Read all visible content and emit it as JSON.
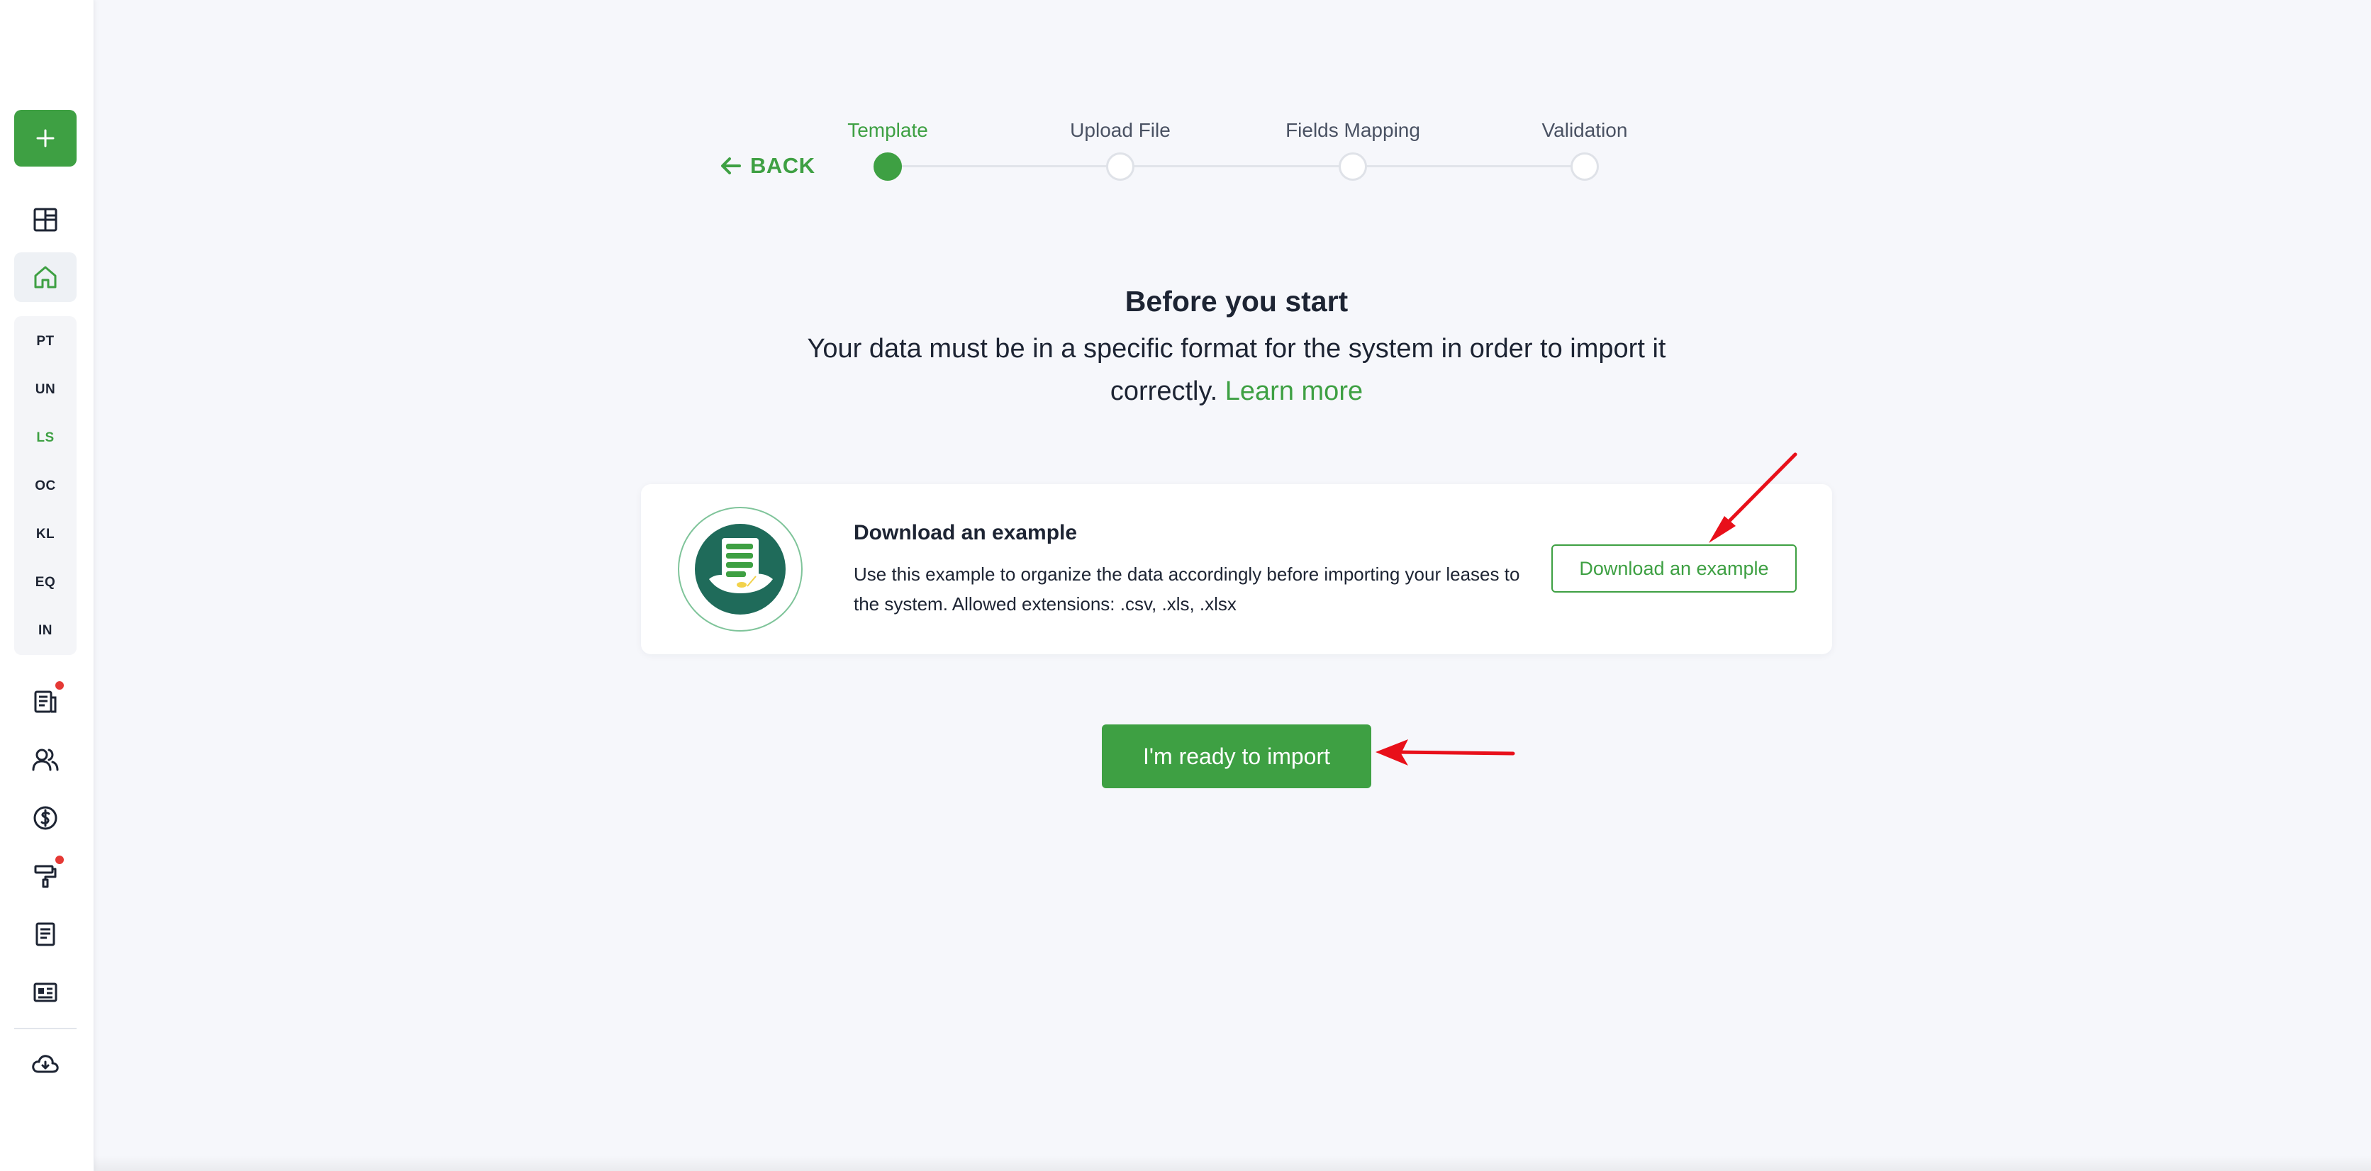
{
  "sidebar": {
    "add_icon": "plus-icon",
    "icons": [
      "dashboard-icon",
      "home-icon",
      "document-icon",
      "users-icon",
      "dollar-icon",
      "paint-roller-icon",
      "report-icon",
      "id-card-icon",
      "cloud-download-icon"
    ],
    "abbreviations": [
      "PT",
      "UN",
      "LS",
      "OC",
      "KL",
      "EQ",
      "IN"
    ],
    "active_abbreviation": "LS"
  },
  "stepper": {
    "back_label": "BACK",
    "steps": [
      {
        "label": "Template",
        "active": true
      },
      {
        "label": "Upload File",
        "active": false
      },
      {
        "label": "Fields Mapping",
        "active": false
      },
      {
        "label": "Validation",
        "active": false
      }
    ]
  },
  "intro": {
    "title": "Before you start",
    "text": "Your data must be in a specific format for the system in order to import it correctly.",
    "learn_more": "Learn more"
  },
  "example_card": {
    "title": "Download an example",
    "description": "Use this example to organize the data accordingly before importing your leases to the system. Allowed extensions: .csv, .xls, .xlsx",
    "button_label": "Download an example"
  },
  "primary_button": {
    "label": "I'm ready to import"
  },
  "colors": {
    "accent": "#3ea043",
    "background": "#f6f7fb",
    "illustration_dark": "#1f6b5a",
    "badge": "#e53935",
    "annotation": "#e8101a"
  }
}
